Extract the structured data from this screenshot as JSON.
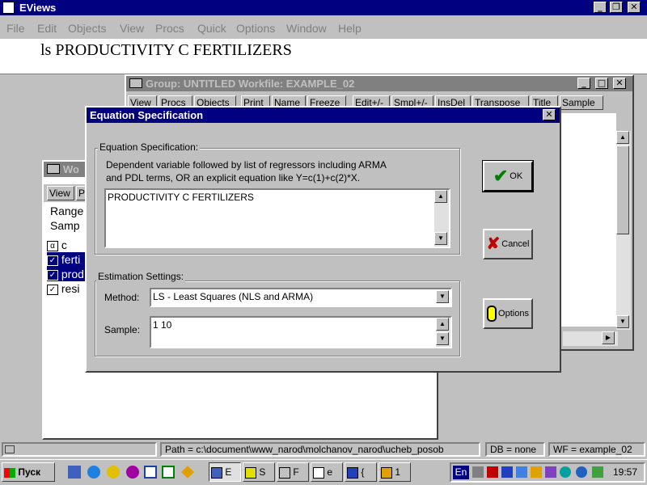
{
  "app": {
    "title": "EViews"
  },
  "menu": [
    "File",
    "Edit",
    "Objects",
    "View",
    "Procs",
    "Quick",
    "Options",
    "Window",
    "Help"
  ],
  "command": "ls PRODUCTIVITY C FERTILIZERS",
  "group_window": {
    "title": "Group: UNTITLED   Workfile: EXAMPLE_02",
    "toolbar": [
      "View",
      "Procs",
      "Objects",
      "Print",
      "Name",
      "Freeze",
      "Edit+/-",
      "Smpl+/-",
      "InsDel",
      "Transpose",
      "Title",
      "Sample"
    ]
  },
  "workfile_window": {
    "title": "Wo",
    "toolbar": [
      "View",
      "P"
    ],
    "info": [
      "Range",
      "Samp"
    ],
    "items": [
      "c",
      "ferti",
      "prod",
      "resi"
    ]
  },
  "dialog": {
    "title": "Equation Specification",
    "spec_group_label": "Equation Specification:",
    "description_line1": "Dependent variable followed by list of regressors including ARMA",
    "description_line2": "and PDL terms, OR an explicit equation like Y=c(1)+c(2)*X.",
    "equation_text": "PRODUCTIVITY C FERTILIZERS",
    "settings_group_label": "Estimation Settings:",
    "method_label": "Method:",
    "method_value": "LS  -  Least Squares (NLS and ARMA)",
    "sample_label": "Sample:",
    "sample_value": "1 10",
    "ok_label": "OK",
    "cancel_label": "Cancel",
    "options_label": "Options"
  },
  "statusbar": {
    "path": "Path = c:\\document\\www_narod\\molchanov_narod\\ucheb_posob",
    "db": "DB = none",
    "wf": "WF = example_02"
  },
  "taskbar": {
    "start": "Пуск",
    "tasks": [
      "E",
      "S",
      "F",
      "e",
      "{",
      "1"
    ],
    "lang": "En",
    "time": "19:57"
  }
}
